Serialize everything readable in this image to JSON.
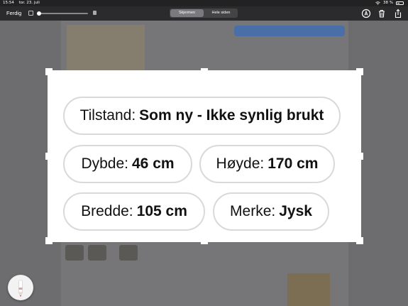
{
  "status_bar": {
    "time": "15:54",
    "date": "tor. 23. juli",
    "battery": "38 %"
  },
  "toolbar": {
    "done_label": "Ferdig",
    "segments": [
      "Skjermen",
      "Hele siden"
    ],
    "selected_segment": "Skjermen",
    "opacity_level": 0.0
  },
  "listing": {
    "tilstand_label": "Tilstand:",
    "tilstand_value": "Som ny - Ikke synlig brukt",
    "dybde_label": "Dybde:",
    "dybde_value": "46 cm",
    "hoyde_label": "Høyde:",
    "hoyde_value": "170 cm",
    "bredde_label": "Bredde:",
    "bredde_value": "105 cm",
    "merke_label": "Merke:",
    "merke_value": "Jysk"
  },
  "colors": {
    "pill_border": "#d9d9dc",
    "dim_overlay": "#6d6d6f",
    "toolbar": "#2b2b2d"
  },
  "icons": [
    "crop-icon",
    "markup-icon",
    "trash-icon",
    "share-icon",
    "pencil-icon",
    "wifi-icon",
    "battery-icon"
  ]
}
